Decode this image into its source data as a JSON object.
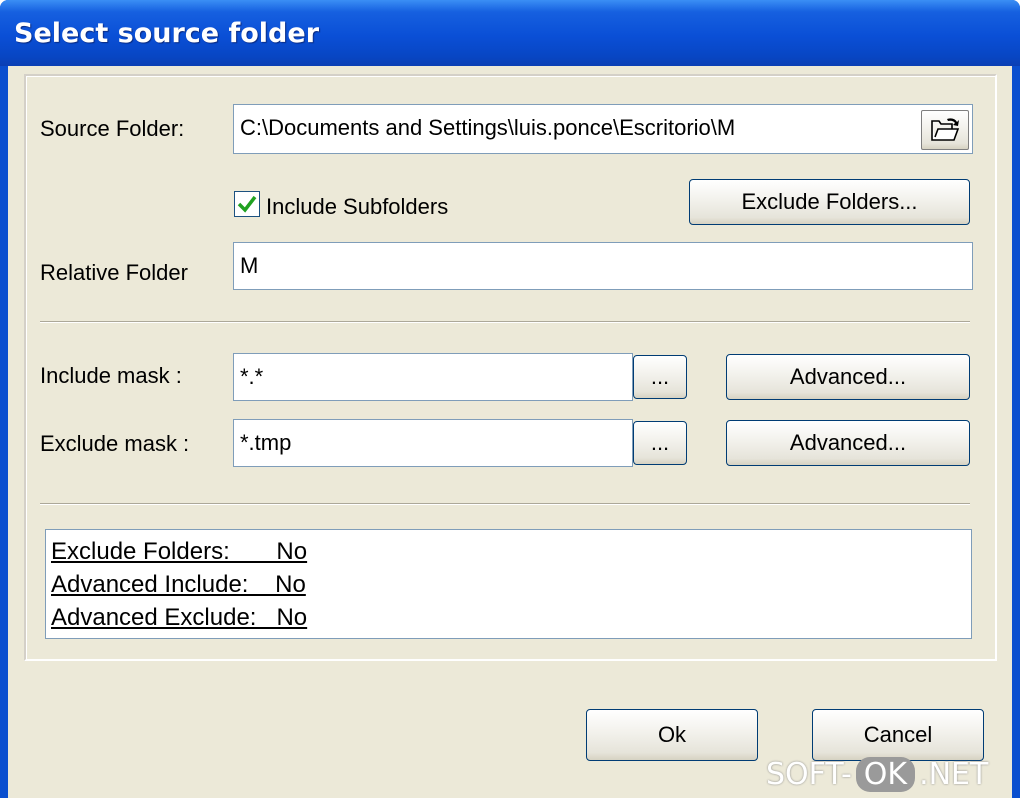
{
  "window": {
    "title": "Select source folder"
  },
  "source": {
    "label": "Source Folder:",
    "value": "C:\\Documents and Settings\\luis.ponce\\Escritorio\\M",
    "browse_icon": "open-folder-icon"
  },
  "subfolders": {
    "label": "Include Subfolders",
    "checked": true
  },
  "exclude_folders_button": "Exclude Folders...",
  "relative": {
    "label": "Relative Folder",
    "value": "M"
  },
  "include_mask": {
    "label": "Include mask :",
    "value": "*.*",
    "browse": "...",
    "advanced": "Advanced..."
  },
  "exclude_mask": {
    "label": "Exclude mask :",
    "value": "*.tmp",
    "browse": "...",
    "advanced": "Advanced..."
  },
  "summary": {
    "line1": "Exclude Folders:       No",
    "line2": "Advanced Include:    No",
    "line3": "Advanced Exclude:   No"
  },
  "buttons": {
    "ok": "Ok",
    "cancel": "Cancel"
  },
  "watermark": {
    "left": "SOFT-",
    "mid": "OK",
    "right": ".NET"
  },
  "colors": {
    "title_bar": "#0a4fd6",
    "client": "#ece9d8",
    "check": "#21a121"
  }
}
